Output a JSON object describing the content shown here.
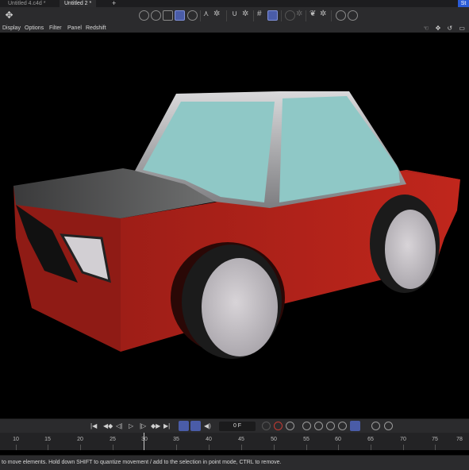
{
  "tabs": [
    {
      "label": "Untitled 4.c4d *"
    },
    {
      "label": "Untitled 2 *"
    }
  ],
  "tab_add": "+",
  "tab_right": "St",
  "menu": {
    "items": [
      "Display",
      "Options",
      "Filter",
      "Panel",
      "Redshift"
    ]
  },
  "toolbar": {
    "icons": [
      "move-tool-icon",
      "model-mode-icon",
      "object-mode-icon",
      "polygon-mode-icon",
      "edge-mode-icon",
      "texture-mode-icon",
      "axis-icon",
      "magnet-icon",
      "snap-icon",
      "workplane-icon",
      "render-icon",
      "paint-icon"
    ]
  },
  "viewport_icons": "☜ ✥ ↺ ▭",
  "timeline": {
    "frame": "0 F"
  },
  "ruler": {
    "labels": [
      "10",
      "15",
      "20",
      "25",
      "30",
      "35",
      "40",
      "45",
      "50",
      "55",
      "60",
      "65",
      "70",
      "75",
      "78"
    ]
  },
  "status": {
    "text": "to move elements. Hold down SHIFT to quantize movement / add to the selection in point mode, CTRL to remove."
  },
  "colors": {
    "car_body": "#b3231b",
    "window_glass": "#8fc8c6",
    "chrome": "#a9a9ab",
    "hood": "#555657",
    "tire": "#1b1b1b",
    "hubcap": "#c8c5c9",
    "accent_selected": "#4a5ca8"
  }
}
